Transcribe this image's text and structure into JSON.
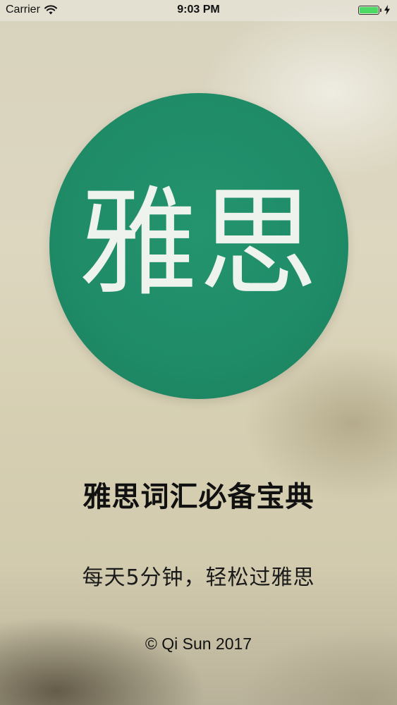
{
  "status_bar": {
    "carrier": "Carrier",
    "wifi_icon": "wifi-icon",
    "time": "9:03 PM",
    "battery_icon": "battery-icon",
    "battery_level": 1.0,
    "charging_icon": "lightning-bolt-icon",
    "battery_color": "#4cd964"
  },
  "logo": {
    "text": "雅思",
    "circle_color": "#1f8b67",
    "text_color": "#eef3ee"
  },
  "headline": "雅思词汇必备宝典",
  "slogan": "每天5分钟，轻松过雅思",
  "copyright": "© Qi Sun 2017"
}
